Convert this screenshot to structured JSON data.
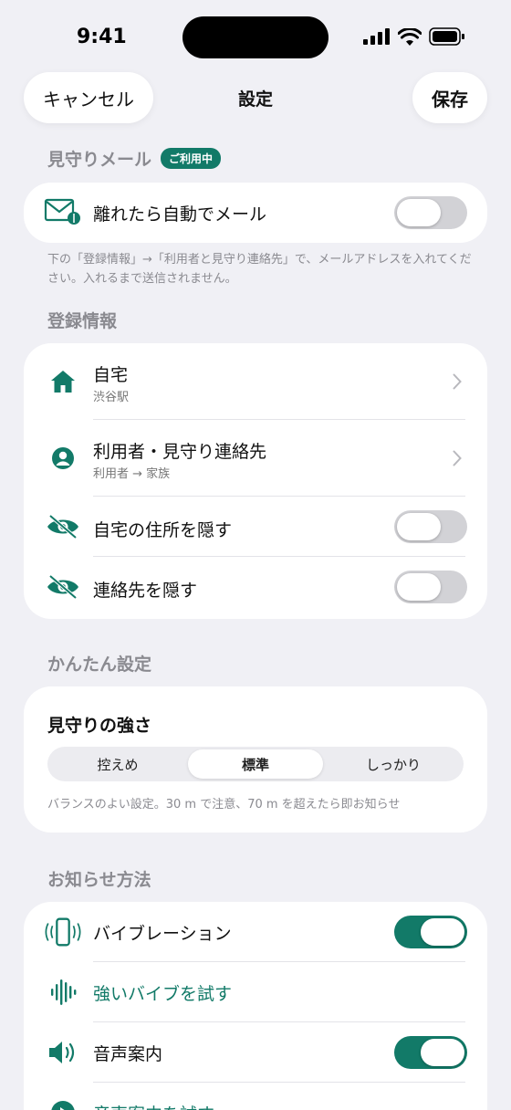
{
  "status_bar": {
    "time": "9:41"
  },
  "nav": {
    "cancel_label": "キャンセル",
    "title": "設定",
    "save_label": "保存"
  },
  "mail_section": {
    "header": "見守りメール",
    "badge": "ご利用中",
    "auto_mail_label": "離れたら自動でメール",
    "auto_mail_on": false,
    "footnote": "下の「登録情報」→「利用者と見守り連絡先」で、メールアドレスを入れてください。入れるまで送信されません。"
  },
  "registration": {
    "header": "登録情報",
    "home": {
      "label": "自宅",
      "sub": "渋谷駅"
    },
    "contacts": {
      "label": "利用者・見守り連絡先",
      "sub": "利用者 → 家族"
    },
    "hide_address": {
      "label": "自宅の住所を隠す",
      "on": false
    },
    "hide_contacts": {
      "label": "連絡先を隠す",
      "on": false
    }
  },
  "easy_settings": {
    "header": "かんたん設定",
    "strength_title": "見守りの強さ",
    "options": [
      "控えめ",
      "標準",
      "しっかり"
    ],
    "selected": "標準",
    "description": "バランスのよい設定。30 m で注意、70 m を超えたら即お知らせ"
  },
  "notify": {
    "header": "お知らせ方法",
    "vibration": {
      "label": "バイブレーション",
      "on": true
    },
    "test_vibration": "強いバイブを試す",
    "voice": {
      "label": "音声案内",
      "on": true
    },
    "test_voice": "音声案内を試す"
  },
  "colors": {
    "accent": "#127a68",
    "background": "#f0f0f5",
    "card": "#ffffff",
    "toggle_off": "#d2d2d6"
  }
}
